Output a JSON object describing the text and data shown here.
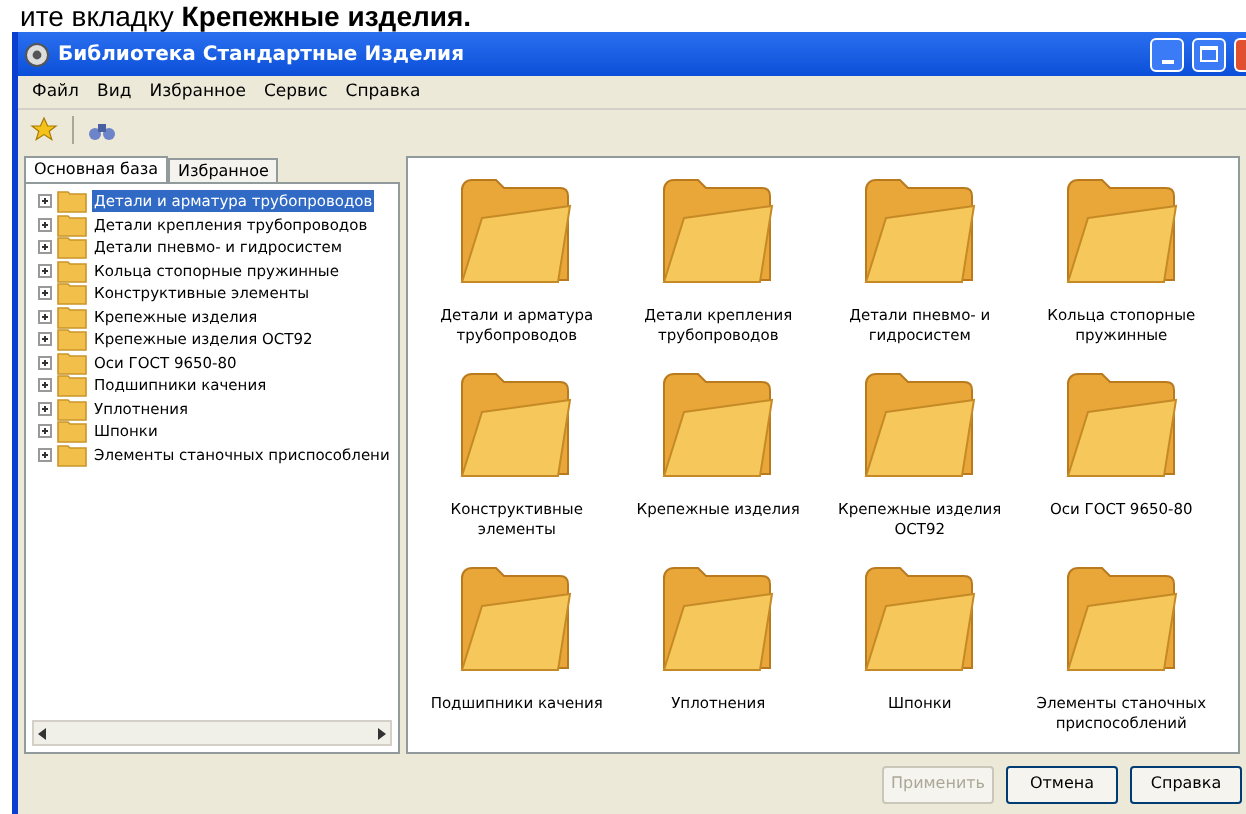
{
  "caption": "ите вкладку **Крепежные изделия.**",
  "window": {
    "title": "Библиотека Стандартные Изделия"
  },
  "menu": [
    "Файл",
    "Вид",
    "Избранное",
    "Сервис",
    "Справка"
  ],
  "tabs": [
    {
      "label": "Основная база",
      "selected": true
    },
    {
      "label": "Избранное",
      "selected": false
    }
  ],
  "tree": [
    {
      "label": "Детали и арматура трубопроводов",
      "selected": true
    },
    {
      "label": "Детали крепления трубопроводов",
      "selected": false
    },
    {
      "label": "Детали пневмо- и гидросистем",
      "selected": false
    },
    {
      "label": "Кольца стопорные пружинные",
      "selected": false
    },
    {
      "label": "Конструктивные элементы",
      "selected": false
    },
    {
      "label": "Крепежные изделия",
      "selected": false
    },
    {
      "label": "Крепежные изделия ОСТ92",
      "selected": false
    },
    {
      "label": "Оси ГОСТ 9650-80",
      "selected": false
    },
    {
      "label": "Подшипники качения",
      "selected": false
    },
    {
      "label": "Уплотнения",
      "selected": false
    },
    {
      "label": "Шпонки",
      "selected": false
    },
    {
      "label": "Элементы станочных приспособлени",
      "selected": false
    }
  ],
  "folders": [
    "Детали и арматура трубопроводов",
    "Детали крепления трубопроводов",
    "Детали пневмо- и гидросистем",
    "Кольца стопорные пружинные",
    "Конструктивные элементы",
    "Крепежные изделия",
    "Крепежные изделия ОСТ92",
    "Оси ГОСТ 9650-80",
    "Подшипники качения",
    "Уплотнения",
    "Шпонки",
    "Элементы станочных приспособлений"
  ],
  "buttons": [
    {
      "label": "Применить",
      "disabled": true
    },
    {
      "label": "Отмена",
      "disabled": false
    },
    {
      "label": "Справка",
      "disabled": false
    }
  ]
}
